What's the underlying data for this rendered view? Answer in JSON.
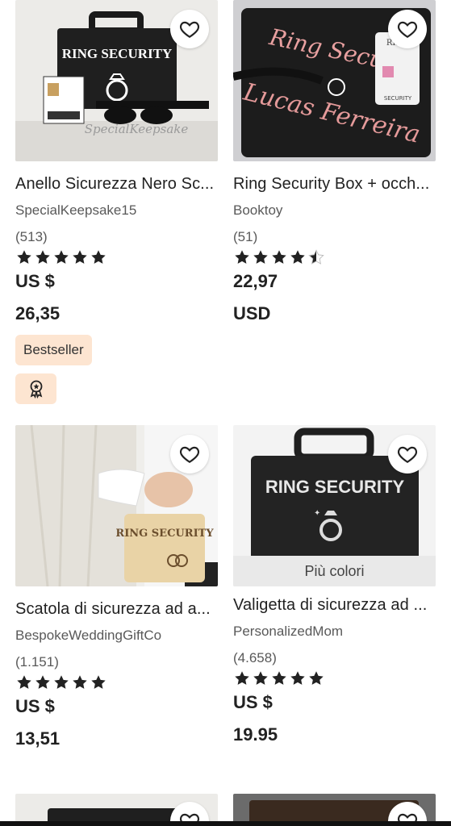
{
  "colors": {
    "accent_badge": "#fde5d1",
    "star": "#222222"
  },
  "products": [
    {
      "title": "Anello Sicurezza Nero Sc...",
      "shop": "SpecialKeepsake15",
      "reviews": "(513)",
      "rating": 5,
      "currency": "US $",
      "price": "26,35",
      "badge": "Bestseller",
      "has_star_seller": true,
      "image_text": "RING SECURITY",
      "watermark": "SpecialKeepsake"
    },
    {
      "title": "Ring Security Box + occh...",
      "shop": "Booktoy",
      "reviews": "(51)",
      "rating": 4.5,
      "price": "22,97",
      "currency": "USD",
      "image_text": "Ring Securi",
      "image_name": "Lucas Ferreira",
      "tag_top": "RING",
      "tag_bottom": "SECURITY"
    },
    {
      "title": "Scatola di sicurezza ad a...",
      "shop": "BespokeWeddingGiftCo",
      "reviews": "(1.151)",
      "rating": 5,
      "currency": "US $",
      "price": "13,51",
      "image_text": "RING SECURITY"
    },
    {
      "title": "Valigetta di sicurezza ad ...",
      "shop": "PersonalizedMom",
      "reviews": "(4.658)",
      "rating": 5,
      "currency": "US $",
      "price": "19.95",
      "more_colors": "Più colori",
      "image_text": "RING SECURITY"
    }
  ],
  "icons": {
    "favorite": "heart-outline-icon",
    "rating": "star-icon",
    "star_seller": "award-icon"
  }
}
